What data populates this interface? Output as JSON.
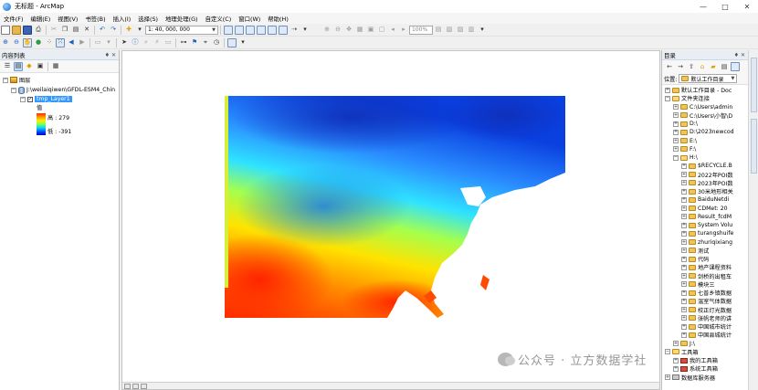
{
  "window": {
    "title": "无标题 - ArcMap",
    "controls": [
      "—",
      "□",
      "✕"
    ]
  },
  "menus": [
    "文件(F)",
    "编辑(E)",
    "视图(V)",
    "书签(B)",
    "插入(I)",
    "选择(S)",
    "地理处理(G)",
    "自定义(C)",
    "窗口(W)",
    "帮助(H)"
  ],
  "toolbar": {
    "scale": "1: 40, 000, 000",
    "zoom_percent": "100%"
  },
  "toc": {
    "header": "内容列表",
    "pin": "♦ ✕",
    "root": "图层",
    "folder": "J:\\weilaiqiwen\\GFDL-ESM4_Chin",
    "layer": "tmp_Layer1",
    "legend_title": "值",
    "legend_high": "高 : 279",
    "legend_low": "低 : -391"
  },
  "catalog": {
    "header": "目录",
    "pin": "♦ ✕",
    "location_label": "位置:",
    "location_value": "默认工作目录",
    "items": [
      {
        "label": "默认工作目录 - Doc",
        "depth": 0,
        "type": "folder"
      },
      {
        "label": "文件夹连接",
        "depth": 0,
        "type": "folder-open"
      },
      {
        "label": "C:\\Users\\admin",
        "depth": 1,
        "type": "folder"
      },
      {
        "label": "C:\\Users\\小智\\D",
        "depth": 1,
        "type": "folder"
      },
      {
        "label": "D:\\",
        "depth": 1,
        "type": "folder"
      },
      {
        "label": "D:\\2023newcod",
        "depth": 1,
        "type": "folder"
      },
      {
        "label": "E:\\",
        "depth": 1,
        "type": "folder"
      },
      {
        "label": "F:\\",
        "depth": 1,
        "type": "folder"
      },
      {
        "label": "H:\\",
        "depth": 1,
        "type": "folder-open"
      },
      {
        "label": "$RECYCLE.B",
        "depth": 2,
        "type": "folder"
      },
      {
        "label": "2022年POI数",
        "depth": 2,
        "type": "folder"
      },
      {
        "label": "2023年POI数",
        "depth": 2,
        "type": "folder"
      },
      {
        "label": "30米地形相关",
        "depth": 2,
        "type": "folder"
      },
      {
        "label": "BaiduNetdi",
        "depth": 2,
        "type": "folder"
      },
      {
        "label": "CDMet: 20",
        "depth": 2,
        "type": "folder"
      },
      {
        "label": "Result_fcdM",
        "depth": 2,
        "type": "folder"
      },
      {
        "label": "System Volu",
        "depth": 2,
        "type": "folder"
      },
      {
        "label": "turangshuife",
        "depth": 2,
        "type": "folder"
      },
      {
        "label": "zhuriqixiang",
        "depth": 2,
        "type": "folder"
      },
      {
        "label": "测试",
        "depth": 2,
        "type": "folder"
      },
      {
        "label": "代码",
        "depth": 2,
        "type": "folder"
      },
      {
        "label": "地产课程资料",
        "depth": 2,
        "type": "folder"
      },
      {
        "label": "剑桥的出租车",
        "depth": 2,
        "type": "folder"
      },
      {
        "label": "模块三",
        "depth": 2,
        "type": "folder"
      },
      {
        "label": "七普乡镇数据",
        "depth": 2,
        "type": "folder"
      },
      {
        "label": "温室气体数据",
        "depth": 2,
        "type": "folder"
      },
      {
        "label": "校正灯光数据",
        "depth": 2,
        "type": "folder"
      },
      {
        "label": "张帆老师的讲",
        "depth": 2,
        "type": "folder"
      },
      {
        "label": "中国城市统计",
        "depth": 2,
        "type": "folder"
      },
      {
        "label": "中国县城统计",
        "depth": 2,
        "type": "folder"
      },
      {
        "label": "J:\\",
        "depth": 1,
        "type": "folder"
      },
      {
        "label": "工具箱",
        "depth": 0,
        "type": "folder-open"
      },
      {
        "label": "我的工具箱",
        "depth": 1,
        "type": "toolbox"
      },
      {
        "label": "系统工具箱",
        "depth": 1,
        "type": "toolbox"
      },
      {
        "label": "数据库服务器",
        "depth": 0,
        "type": "drive"
      }
    ]
  },
  "watermark": "公众号 · 立方数据学社",
  "colors": {
    "selection": "#3399ff",
    "ramp_high": "#ff2a00",
    "ramp_low": "#0000c0"
  }
}
